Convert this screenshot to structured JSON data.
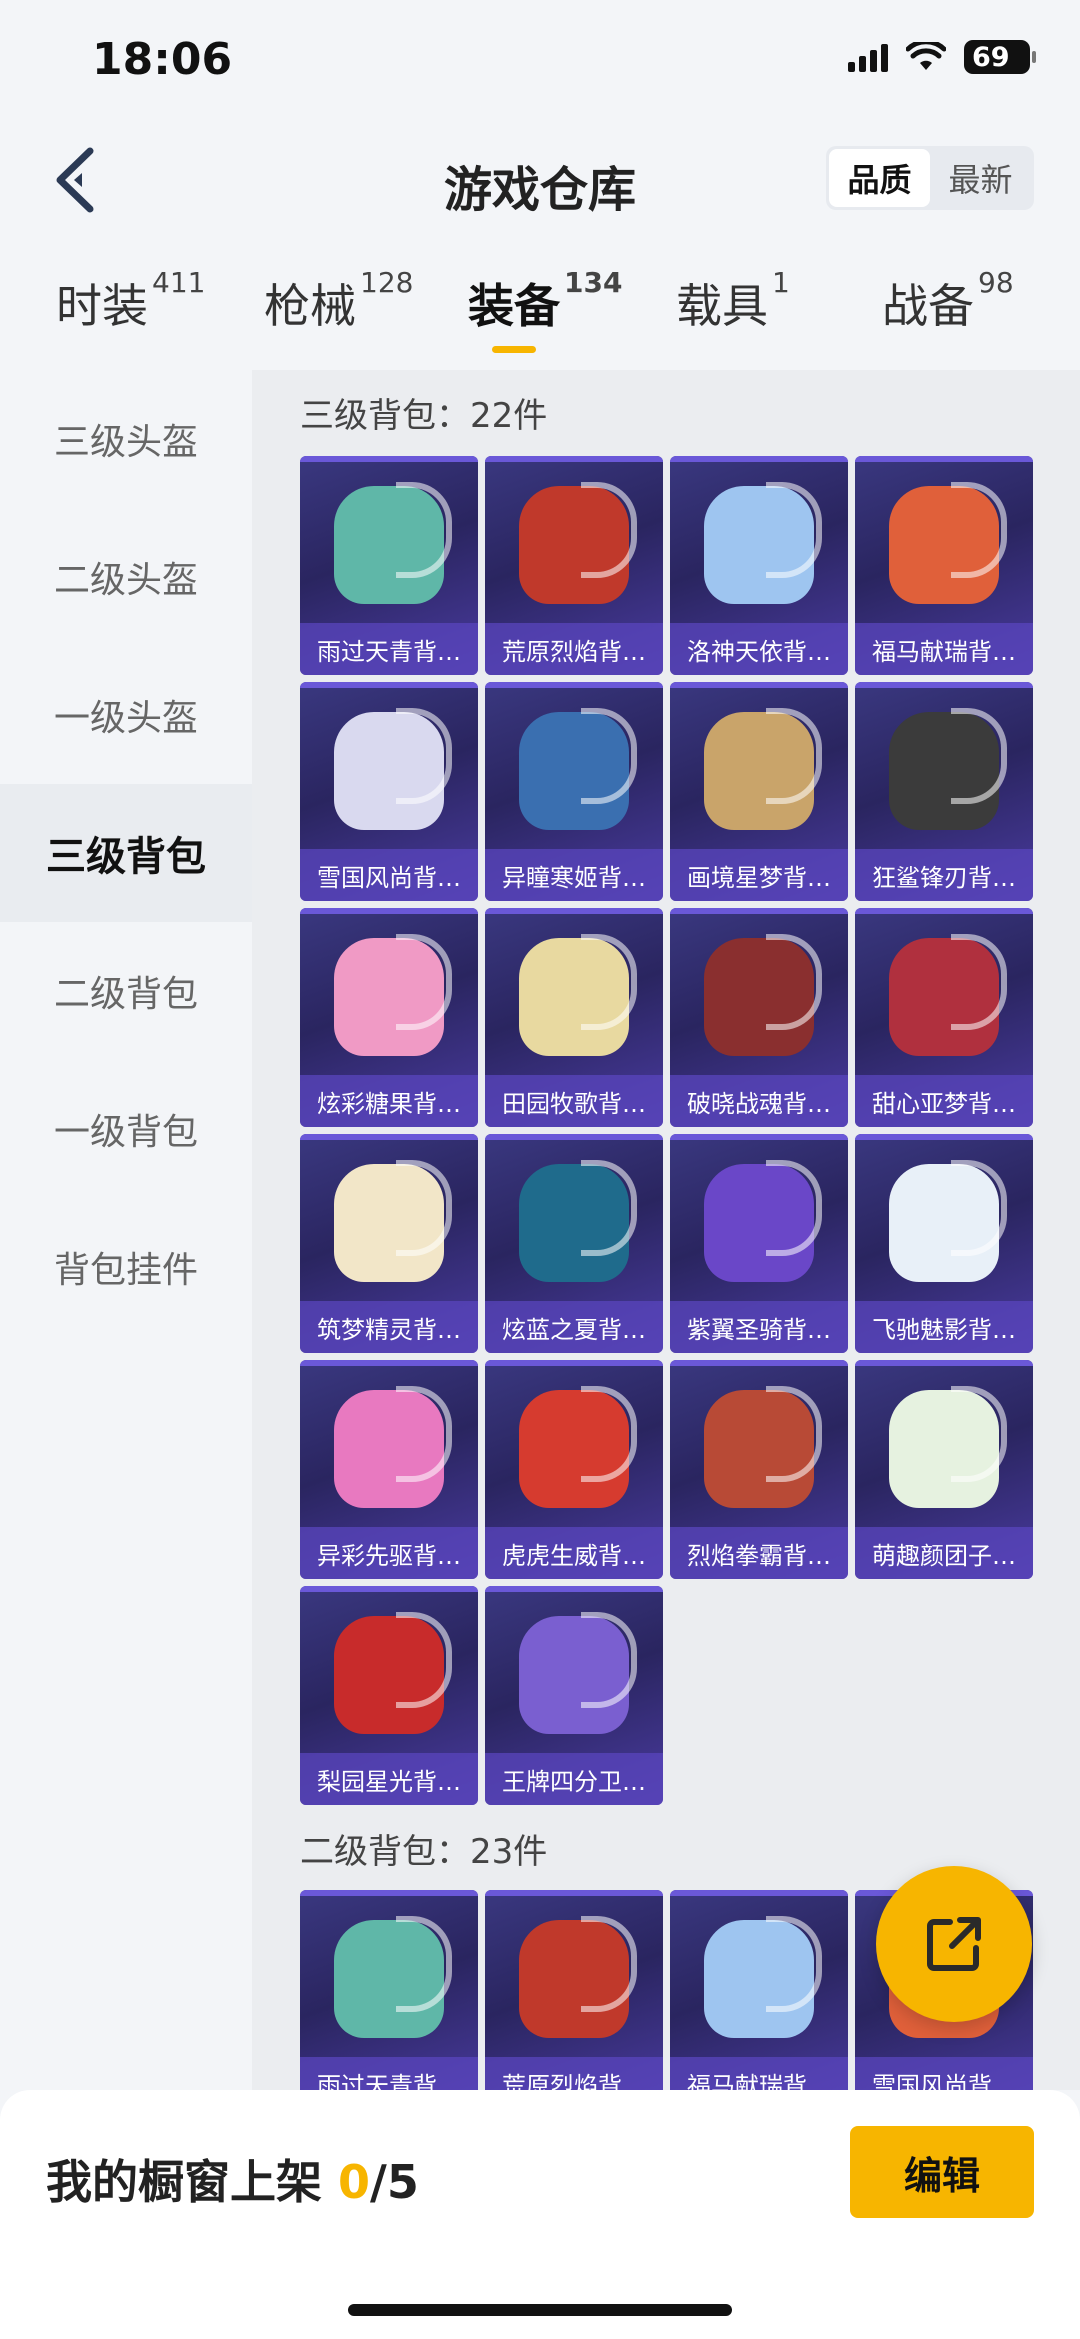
{
  "status": {
    "time": "18:06",
    "battery": "69"
  },
  "header": {
    "title": "游戏仓库",
    "sort_options": [
      "品质",
      "最新"
    ]
  },
  "tabs": [
    {
      "label": "时装",
      "count": "411"
    },
    {
      "label": "枪械",
      "count": "128"
    },
    {
      "label": "装备",
      "count": "134"
    },
    {
      "label": "载具",
      "count": "1"
    },
    {
      "label": "战备",
      "count": "98"
    }
  ],
  "sidebar": {
    "items": [
      "三级头盔",
      "二级头盔",
      "一级头盔",
      "三级背包",
      "二级背包",
      "一级背包",
      "背包挂件"
    ],
    "active": "三级背包"
  },
  "sections": [
    {
      "title": "三级背包：22件",
      "items": [
        "雨过天青背…",
        "荒原烈焰背…",
        "洛神天依背…",
        "福马献瑞背…",
        "雪国风尚背…",
        "异瞳寒姬背…",
        "画境星梦背…",
        "狂鲨锋刃背…",
        "炫彩糖果背…",
        "田园牧歌背…",
        "破晓战魂背…",
        "甜心亚梦背…",
        "筑梦精灵背…",
        "炫蓝之夏背…",
        "紫翼圣骑背…",
        "飞驰魅影背…",
        "异彩先驱背…",
        "虎虎生威背…",
        "烈焰拳霸背…",
        "萌趣颜团子…",
        "梨园星光背…",
        "王牌四分卫…"
      ]
    },
    {
      "title": "二级背包：23件",
      "items": [
        "雨过天青背…",
        "荒原烈焰背…",
        "福马献瑞背…",
        "雪国风尚背…"
      ]
    }
  ],
  "bottom": {
    "shelf_label": "我的橱窗上架 ",
    "shelf_count": "0",
    "shelf_total": "/5",
    "edit_label": "编辑"
  },
  "colors": {
    "accent": "#f7b500",
    "card_bg": "#2a2560",
    "card_label_bg": "#5a46be"
  }
}
